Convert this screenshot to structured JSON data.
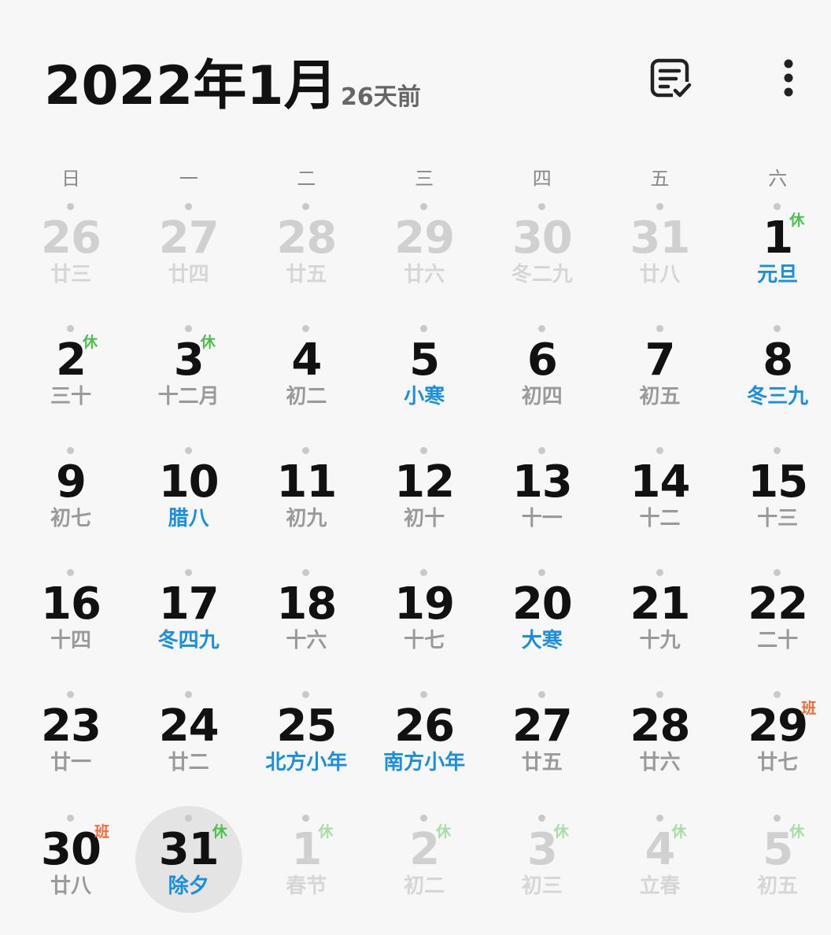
{
  "header": {
    "title": "2022年1月",
    "subtitle": "26天前"
  },
  "weekdays": [
    "日",
    "一",
    "二",
    "三",
    "四",
    "五",
    "六"
  ],
  "colors": {
    "holiday_text": "#1a8fe0",
    "rest_badge": "#4fbf4f",
    "work_badge": "#f26b3a"
  },
  "days": [
    {
      "num": "26",
      "lunar": "廿三",
      "dim": true
    },
    {
      "num": "27",
      "lunar": "廿四",
      "dim": true
    },
    {
      "num": "28",
      "lunar": "廿五",
      "dim": true
    },
    {
      "num": "29",
      "lunar": "廿六",
      "dim": true
    },
    {
      "num": "30",
      "lunar": "冬二九",
      "dim": true
    },
    {
      "num": "31",
      "lunar": "廿八",
      "dim": true
    },
    {
      "num": "1",
      "lunar": "元旦",
      "hl": true,
      "badge": "休",
      "badge_type": "rest"
    },
    {
      "num": "2",
      "lunar": "三十",
      "badge": "休",
      "badge_type": "rest"
    },
    {
      "num": "3",
      "lunar": "十二月",
      "badge": "休",
      "badge_type": "rest"
    },
    {
      "num": "4",
      "lunar": "初二"
    },
    {
      "num": "5",
      "lunar": "小寒",
      "hl": true
    },
    {
      "num": "6",
      "lunar": "初四"
    },
    {
      "num": "7",
      "lunar": "初五"
    },
    {
      "num": "8",
      "lunar": "冬三九",
      "hl": true
    },
    {
      "num": "9",
      "lunar": "初七"
    },
    {
      "num": "10",
      "lunar": "腊八",
      "hl": true
    },
    {
      "num": "11",
      "lunar": "初九"
    },
    {
      "num": "12",
      "lunar": "初十"
    },
    {
      "num": "13",
      "lunar": "十一"
    },
    {
      "num": "14",
      "lunar": "十二"
    },
    {
      "num": "15",
      "lunar": "十三"
    },
    {
      "num": "16",
      "lunar": "十四"
    },
    {
      "num": "17",
      "lunar": "冬四九",
      "hl": true
    },
    {
      "num": "18",
      "lunar": "十六"
    },
    {
      "num": "19",
      "lunar": "十七"
    },
    {
      "num": "20",
      "lunar": "大寒",
      "hl": true
    },
    {
      "num": "21",
      "lunar": "十九"
    },
    {
      "num": "22",
      "lunar": "二十"
    },
    {
      "num": "23",
      "lunar": "廿一"
    },
    {
      "num": "24",
      "lunar": "廿二"
    },
    {
      "num": "25",
      "lunar": "北方小年",
      "hl": true
    },
    {
      "num": "26",
      "lunar": "南方小年",
      "hl": true
    },
    {
      "num": "27",
      "lunar": "廿五"
    },
    {
      "num": "28",
      "lunar": "廿六"
    },
    {
      "num": "29",
      "lunar": "廿七",
      "badge": "班",
      "badge_type": "work"
    },
    {
      "num": "30",
      "lunar": "廿八",
      "badge": "班",
      "badge_type": "work"
    },
    {
      "num": "31",
      "lunar": "除夕",
      "hl": true,
      "badge": "休",
      "badge_type": "rest",
      "today": true
    },
    {
      "num": "1",
      "lunar": "春节",
      "dim": true,
      "badge": "休",
      "badge_type": "rest"
    },
    {
      "num": "2",
      "lunar": "初二",
      "dim": true,
      "badge": "休",
      "badge_type": "rest"
    },
    {
      "num": "3",
      "lunar": "初三",
      "dim": true,
      "badge": "休",
      "badge_type": "rest"
    },
    {
      "num": "4",
      "lunar": "立春",
      "dim": true,
      "badge": "休",
      "badge_type": "rest"
    },
    {
      "num": "5",
      "lunar": "初五",
      "dim": true,
      "badge": "休",
      "badge_type": "rest"
    }
  ]
}
